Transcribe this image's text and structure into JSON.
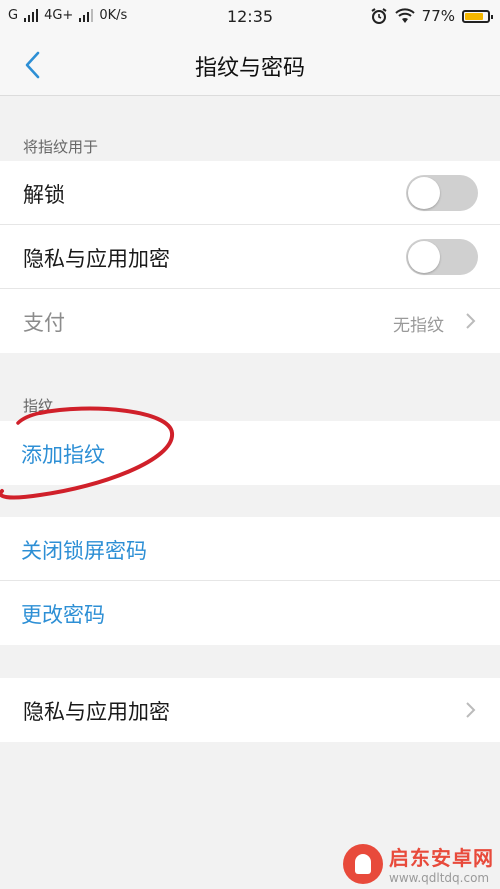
{
  "status_bar": {
    "carrier1": "G",
    "carrier2": "4G+",
    "speed": "0K/s",
    "time": "12:35",
    "battery": "77%",
    "battery_level_percent": 77
  },
  "nav": {
    "title": "指纹与密码"
  },
  "section_use": {
    "header": "将指纹用于",
    "rows": [
      {
        "label": "解锁",
        "toggle": false
      },
      {
        "label": "隐私与应用加密",
        "toggle": false
      },
      {
        "label": "支付",
        "value": "无指纹"
      }
    ]
  },
  "section_fingerprint": {
    "header": "指纹",
    "add_label": "添加指纹"
  },
  "section_password": {
    "rows": [
      {
        "label": "关闭锁屏密码"
      },
      {
        "label": "更改密码"
      }
    ]
  },
  "section_privacy": {
    "label": "隐私与应用加密"
  },
  "watermark": {
    "name": "启东安卓网",
    "url": "www.qdltdq.com"
  },
  "colors": {
    "accent": "#2d8fd5",
    "toggle_off": "#d0d0d0",
    "annotation": "#d0202a"
  }
}
